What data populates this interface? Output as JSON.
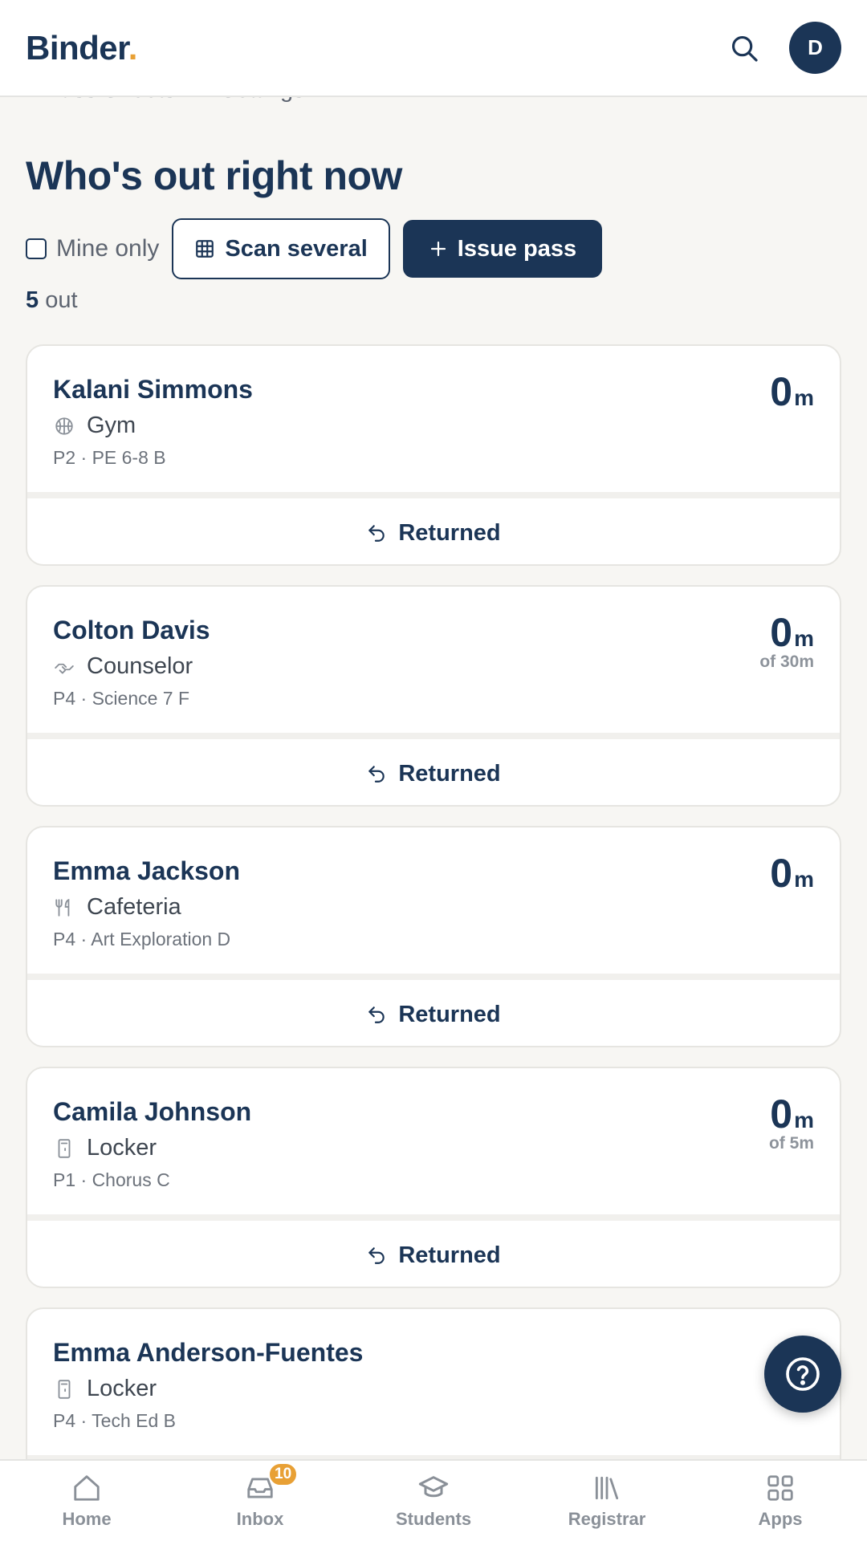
{
  "app": {
    "logo_text": "Binder",
    "logo_dot": ".",
    "avatar_initial": "D",
    "accent_color": "#e8a035",
    "brand_color": "#1b3556"
  },
  "subtabs": [
    "Pass Sheets",
    "Settings"
  ],
  "page": {
    "title": "Who's out right now",
    "mine_only_label": "Mine only",
    "scan_label": "Scan several",
    "issue_label": "Issue pass",
    "count_value": "5",
    "count_suffix": "out"
  },
  "passes": [
    {
      "name": "Kalani Simmons",
      "destination": "Gym",
      "destination_icon": "basketball-icon",
      "period": "P2 · PE 6-8 B",
      "elapsed": "0",
      "unit": "m",
      "limit": "",
      "action": "Returned"
    },
    {
      "name": "Colton Davis",
      "destination": "Counselor",
      "destination_icon": "handshake-icon",
      "period": "P4 · Science 7 F",
      "elapsed": "0",
      "unit": "m",
      "limit": "of 30m",
      "action": "Returned"
    },
    {
      "name": "Emma Jackson",
      "destination": "Cafeteria",
      "destination_icon": "utensils-icon",
      "period": "P4 · Art Exploration D",
      "elapsed": "0",
      "unit": "m",
      "limit": "",
      "action": "Returned"
    },
    {
      "name": "Camila Johnson",
      "destination": "Locker",
      "destination_icon": "locker-icon",
      "period": "P1 · Chorus C",
      "elapsed": "0",
      "unit": "m",
      "limit": "of 5m",
      "action": "Returned"
    },
    {
      "name": "Emma Anderson-Fuentes",
      "destination": "Locker",
      "destination_icon": "locker-icon",
      "period": "P4 · Tech Ed B",
      "elapsed": "",
      "unit": "",
      "limit": "",
      "action": ""
    }
  ],
  "nav": {
    "home": "Home",
    "inbox": "Inbox",
    "inbox_badge": "10",
    "students": "Students",
    "registrar": "Registrar",
    "apps": "Apps"
  }
}
